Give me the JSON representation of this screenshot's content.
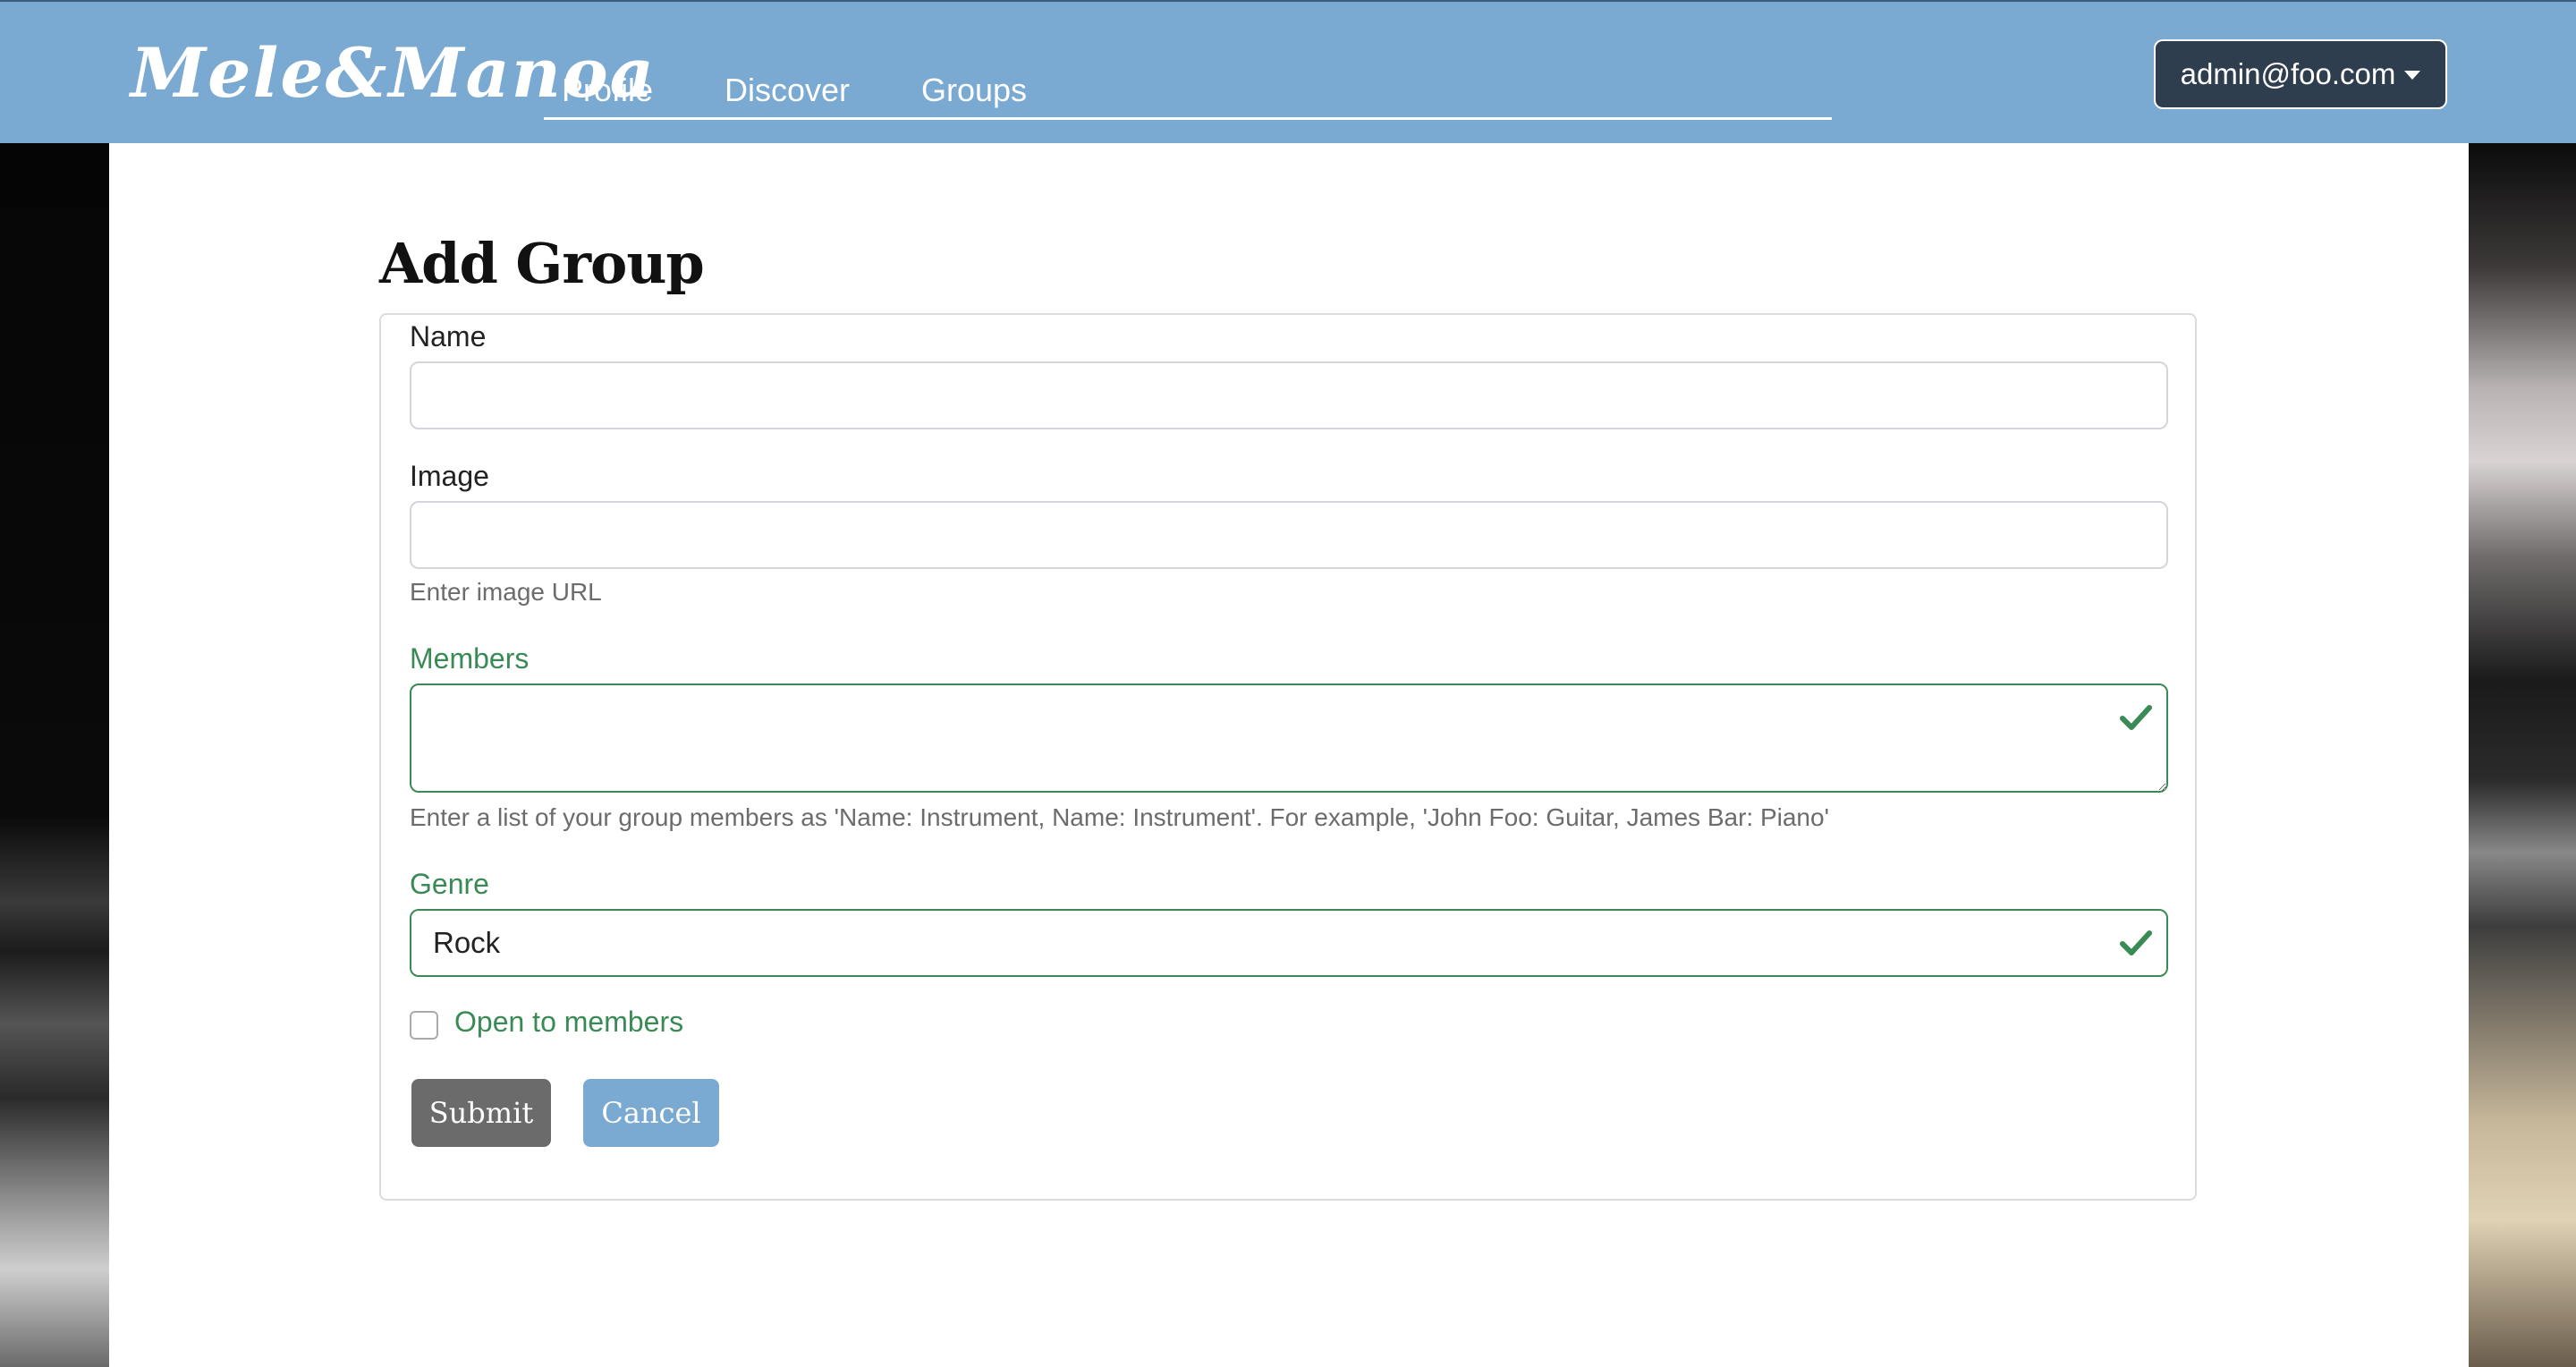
{
  "navbar": {
    "brand": "Mele&Manoa",
    "links": [
      "Profile",
      "Discover",
      "Groups"
    ],
    "user": "admin@foo.com"
  },
  "page": {
    "title": "Add Group"
  },
  "form": {
    "name_label": "Name",
    "name_value": "",
    "image_label": "Image",
    "image_value": "",
    "image_help": "Enter image URL",
    "members_label": "Members",
    "members_value": "",
    "members_help": "Enter a list of your group members as 'Name: Instrument, Name: Instrument'. For example, 'John Foo: Guitar, James Bar: Piano'",
    "genre_label": "Genre",
    "genre_value": "Rock",
    "open_label": "Open to members",
    "open_checked": false,
    "submit_label": "Submit",
    "cancel_label": "Cancel"
  },
  "colors": {
    "navbar": "#7aa9d1",
    "valid": "#3a8a55",
    "user_menu": "#2f3e4e",
    "submit": "#6b6b6b",
    "cancel": "#7aa9d1"
  },
  "icons": {
    "valid": "check-icon",
    "dropdown": "caret-down-icon"
  }
}
